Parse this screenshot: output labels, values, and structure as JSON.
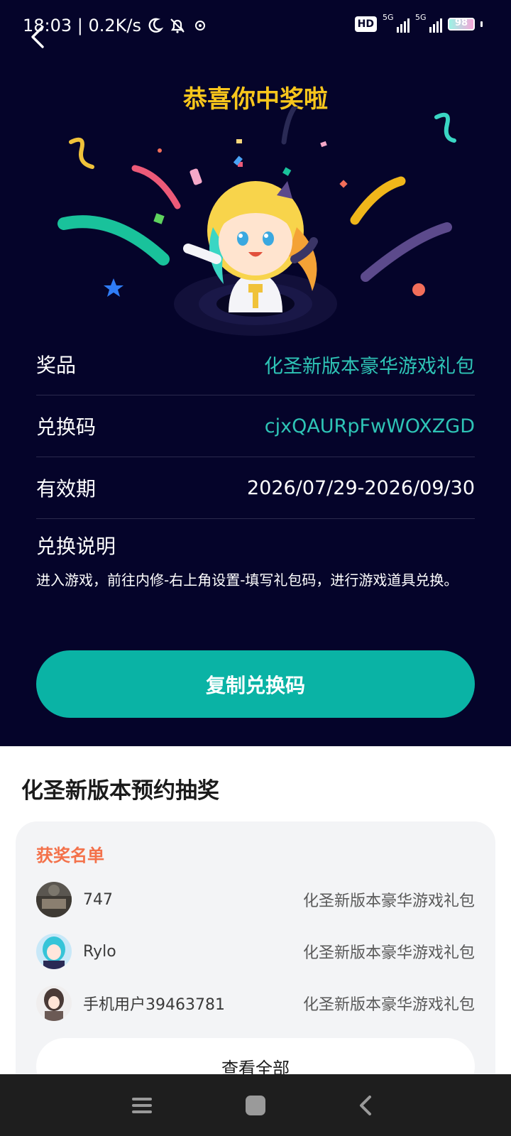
{
  "status_bar": {
    "time_speed": "18:03 | 0.2K/s",
    "hd_label": "HD",
    "network_1": "5G",
    "network_2": "5G",
    "battery": "98",
    "icons": [
      "moon-icon",
      "mute-bell-icon",
      "app-notification-icon",
      "signal-icon",
      "battery-icon"
    ]
  },
  "header": {
    "back_icon": "back-arrow-icon",
    "title": "恭喜你中奖啦"
  },
  "prize_info": {
    "rows": [
      {
        "label": "奖品",
        "value": "化圣新版本豪华游戏礼包"
      },
      {
        "label": "兑换码",
        "value": "cjxQAURpFwWOXZGD"
      },
      {
        "label": "有效期",
        "value": "2026/07/29-2026/09/30"
      }
    ],
    "instructions_title": "兑换说明",
    "instructions_text": "进入游戏，前往内修-右上角设置-填写礼包码，进行游戏道具兑换。",
    "copy_button": "复制兑换码"
  },
  "lottery": {
    "title": "化圣新版本预约抽奖",
    "winners_title": "获奖名单",
    "winners": [
      {
        "name": "747",
        "prize": "化圣新版本豪华游戏礼包"
      },
      {
        "name": "Rylo",
        "prize": "化圣新版本豪华游戏礼包"
      },
      {
        "name": "手机用户39463781",
        "prize": "化圣新版本豪华游戏礼包"
      }
    ],
    "view_all": "查看全部"
  },
  "nav_bar": {
    "icons": [
      "menu-icon",
      "home-icon",
      "back-icon"
    ]
  },
  "colors": {
    "dark_bg": "#05042a",
    "title_gold": "#f8c61c",
    "teal_accent": "#2ec4b6",
    "button_teal": "#0ab3a5",
    "winners_orange": "#f3714a"
  }
}
